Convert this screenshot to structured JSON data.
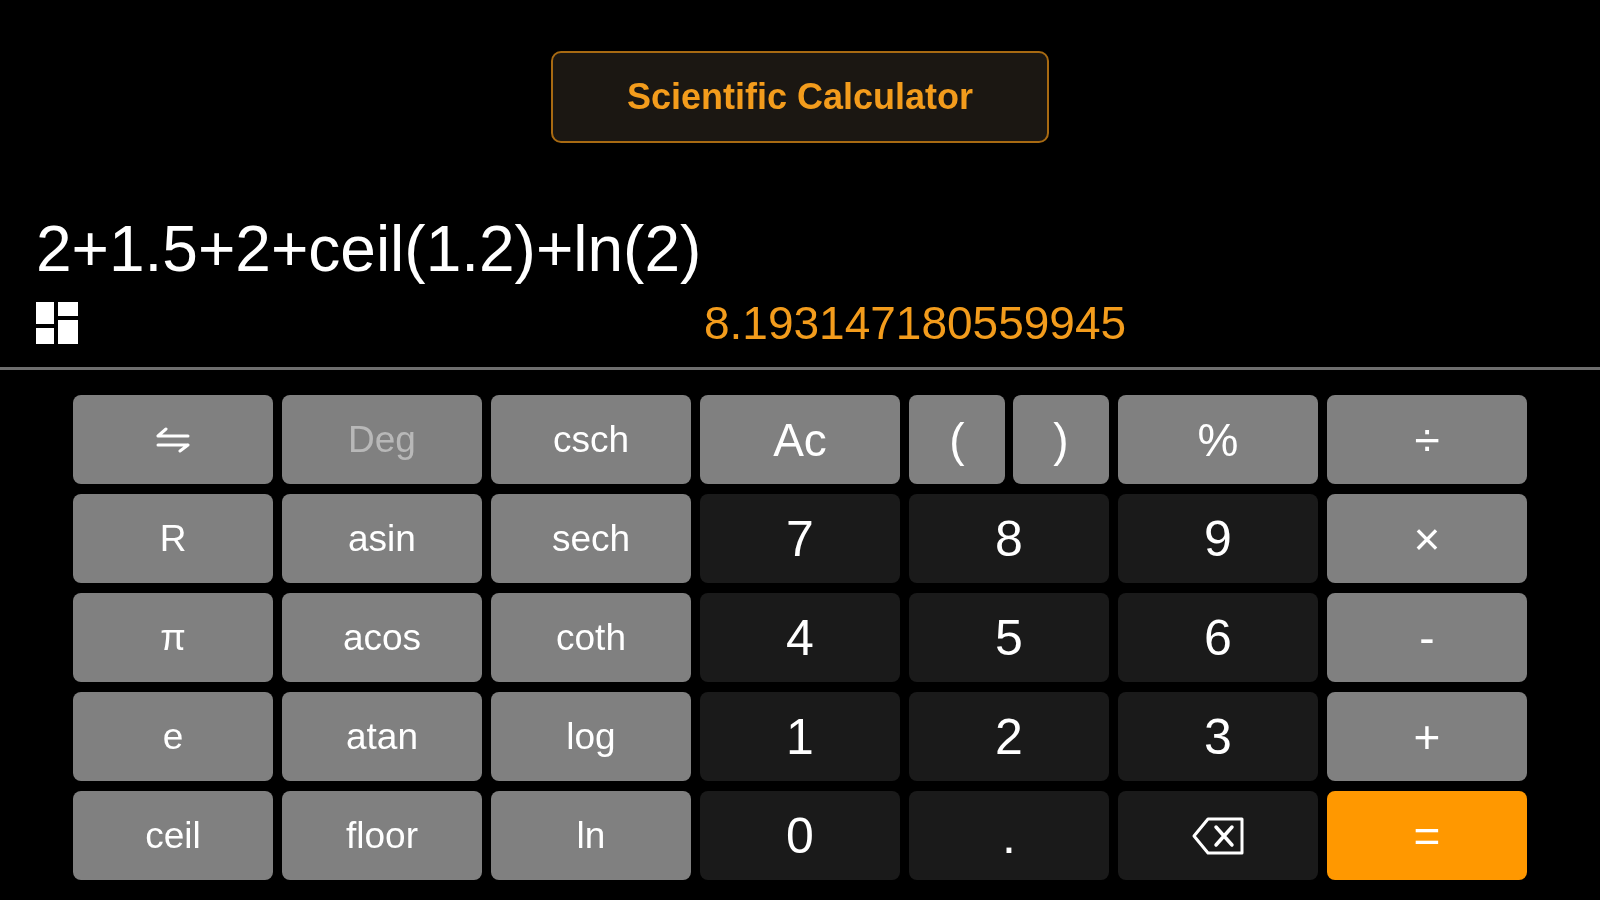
{
  "title": "Scientific Calculator",
  "display": {
    "expression": "2+1.5+2+ceil(1.2)+ln(2)",
    "result": "8.193147180559945"
  },
  "keypad": {
    "rows": [
      [
        {
          "kind": "swap",
          "disabled": false
        },
        {
          "kind": "function",
          "label": "Deg",
          "disabled": true
        },
        {
          "kind": "function",
          "label": "csch",
          "disabled": false
        },
        {
          "kind": "operator",
          "label": "Ac",
          "disabled": false
        },
        {
          "kind": "split",
          "keys": [
            {
              "label": "(",
              "disabled": false
            },
            {
              "label": ")",
              "disabled": false
            }
          ]
        },
        {
          "kind": "operator",
          "label": "%",
          "disabled": false
        },
        {
          "kind": "operator",
          "label": "÷",
          "disabled": false
        }
      ],
      [
        {
          "kind": "function",
          "label": "R",
          "disabled": false
        },
        {
          "kind": "function",
          "label": "asin",
          "disabled": false
        },
        {
          "kind": "function",
          "label": "sech",
          "disabled": false
        },
        {
          "kind": "digit",
          "label": "7",
          "disabled": false
        },
        {
          "kind": "digit",
          "label": "8",
          "disabled": false
        },
        {
          "kind": "digit",
          "label": "9",
          "disabled": false
        },
        {
          "kind": "operator",
          "label": "×",
          "disabled": false
        }
      ],
      [
        {
          "kind": "function",
          "label": "π",
          "disabled": false
        },
        {
          "kind": "function",
          "label": "acos",
          "disabled": false
        },
        {
          "kind": "function",
          "label": "coth",
          "disabled": false
        },
        {
          "kind": "digit",
          "label": "4",
          "disabled": false
        },
        {
          "kind": "digit",
          "label": "5",
          "disabled": false
        },
        {
          "kind": "digit",
          "label": "6",
          "disabled": false
        },
        {
          "kind": "operator",
          "label": "-",
          "disabled": false
        }
      ],
      [
        {
          "kind": "function",
          "label": "e",
          "disabled": false
        },
        {
          "kind": "function",
          "label": "atan",
          "disabled": false
        },
        {
          "kind": "function",
          "label": "log",
          "disabled": false
        },
        {
          "kind": "digit",
          "label": "1",
          "disabled": false
        },
        {
          "kind": "digit",
          "label": "2",
          "disabled": false
        },
        {
          "kind": "digit",
          "label": "3",
          "disabled": false
        },
        {
          "kind": "operator",
          "label": "+",
          "disabled": false
        }
      ],
      [
        {
          "kind": "function",
          "label": "ceil",
          "disabled": false
        },
        {
          "kind": "function",
          "label": "floor",
          "disabled": false
        },
        {
          "kind": "function",
          "label": "ln",
          "disabled": false
        },
        {
          "kind": "digit",
          "label": "0",
          "disabled": false
        },
        {
          "kind": "digit",
          "label": ".",
          "disabled": false
        },
        {
          "kind": "backspace",
          "disabled": false
        },
        {
          "kind": "equals",
          "label": "=",
          "disabled": false
        }
      ]
    ]
  }
}
